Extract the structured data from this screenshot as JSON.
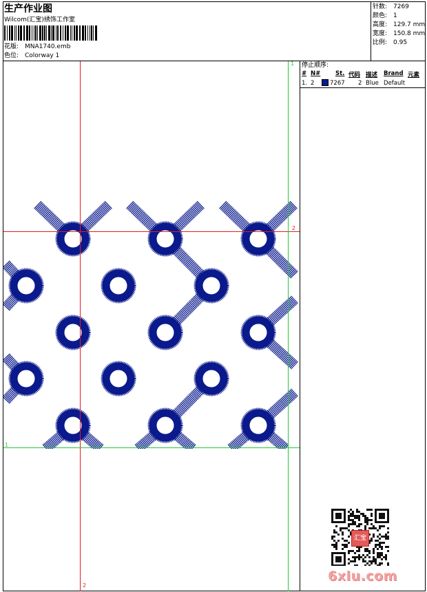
{
  "header": {
    "title": "生产作业图",
    "company": "Wilcom(汇宝)绣饰工作室",
    "design_label": "花版:",
    "design_value": "MNA1740.emb",
    "colorway_label": "色位:",
    "colorway_value": "Colorway 1"
  },
  "stats": [
    {
      "label": "针数:",
      "value": "7269"
    },
    {
      "label": "颜色:",
      "value": "1"
    },
    {
      "label": "高度:",
      "value": "129.7 mm"
    },
    {
      "label": "宽度:",
      "value": "150.8 mm"
    },
    {
      "label": "比例:",
      "value": "0.95"
    }
  ],
  "stop_sequence": {
    "title": "停止顺序:",
    "columns": [
      "#",
      "N#",
      "St.",
      "代码",
      "描述",
      "Brand",
      "元素"
    ],
    "rows": [
      {
        "index": "1.",
        "needle": "2",
        "swatch_color": "#0a1a8c",
        "stitches": "7267",
        "code": "2",
        "description": "Blue",
        "brand": "Default",
        "element": ""
      }
    ]
  },
  "guides": {
    "top_right_label": "1",
    "right_label": "2",
    "left_label": "1",
    "bottom_label": "2",
    "red_color": "#e41c1c",
    "green_color": "#22c83a"
  },
  "design": {
    "thread_color": "#0a1a8c",
    "pattern": "lattice"
  },
  "watermark": {
    "site_text": "6xiu.com",
    "seal_text": "汇宝"
  }
}
